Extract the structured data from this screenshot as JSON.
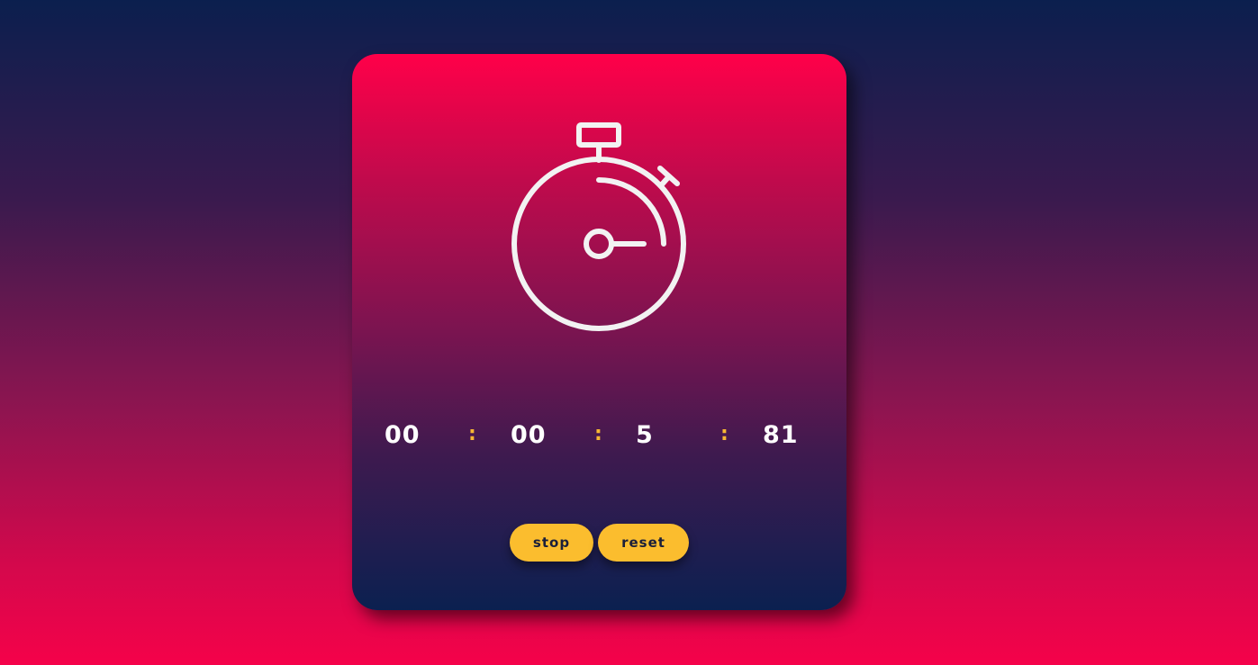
{
  "timer": {
    "hours": "00",
    "minutes": "00",
    "seconds": "5",
    "milliseconds": "81",
    "separator": ":"
  },
  "controls": {
    "stop_label": "stop",
    "reset_label": "reset"
  },
  "icon": {
    "name": "stopwatch-icon"
  },
  "colors": {
    "accent": "#fbbd2e",
    "separator": "#f7b733",
    "card_top": "#ff0049",
    "card_bottom": "#0b2050",
    "digits": "#ffffff"
  }
}
